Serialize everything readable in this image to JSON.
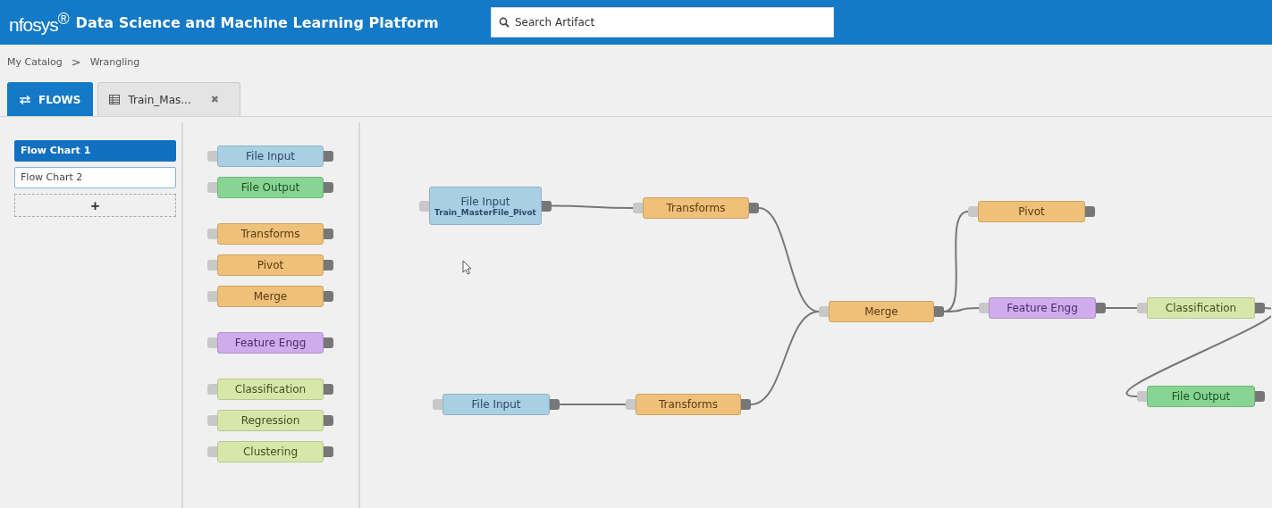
{
  "header": {
    "logo": "nfosys$^{®}$",
    "title": "Data Science and Machine Learning Platform",
    "search": {
      "placeholder": "Search Artifact"
    }
  },
  "breadcrumb": [
    {
      "label": "My Catalog",
      "separator": ">"
    },
    {
      "label": "Wrangling"
    }
  ],
  "tabs": [
    {
      "label": "FLOWS",
      "selected": true
    },
    {
      "label": "Train_Mas...",
      "selected": false,
      "close": "✖"
    }
  ],
  "flow_charts": [
    {
      "label": "Flow Chart 1",
      "selected": true
    },
    {
      "label": "Flow Chart 2",
      "selected": false
    }
  ],
  "add_flow_chart": "+",
  "palette": [
    {
      "items": [
        {
          "label": "File Input",
          "kind": "input"
        },
        {
          "label": "File Output",
          "kind": "output"
        }
      ]
    },
    {
      "items": [
        {
          "label": "Transforms",
          "kind": "wrangle"
        },
        {
          "label": "Pivot",
          "kind": "wrangle"
        },
        {
          "label": "Merge",
          "kind": "wrangle"
        }
      ]
    },
    {
      "items": [
        {
          "label": "Feature Engg",
          "kind": "feature"
        }
      ]
    },
    {
      "items": [
        {
          "label": "Classification",
          "kind": "model"
        },
        {
          "label": "Regression",
          "kind": "model"
        },
        {
          "label": "Clustering",
          "kind": "model"
        }
      ]
    }
  ],
  "canvas": {
    "nodes": [
      {
        "label": "File Input",
        "subtitle": "Train_MasterFile_Pivot",
        "kind": "input"
      },
      {
        "label": "Transforms",
        "kind": "wrangle"
      },
      {
        "label": "Pivot",
        "kind": "wrangle"
      },
      {
        "label": "Merge",
        "kind": "wrangle"
      },
      {
        "label": "Feature Engg",
        "kind": "feature"
      },
      {
        "label": "Classification",
        "kind": "model"
      },
      {
        "label": "File Input",
        "kind": "input"
      },
      {
        "label": "Transforms",
        "kind": "wrangle"
      },
      {
        "label": "File Output",
        "kind": "output"
      }
    ]
  }
}
